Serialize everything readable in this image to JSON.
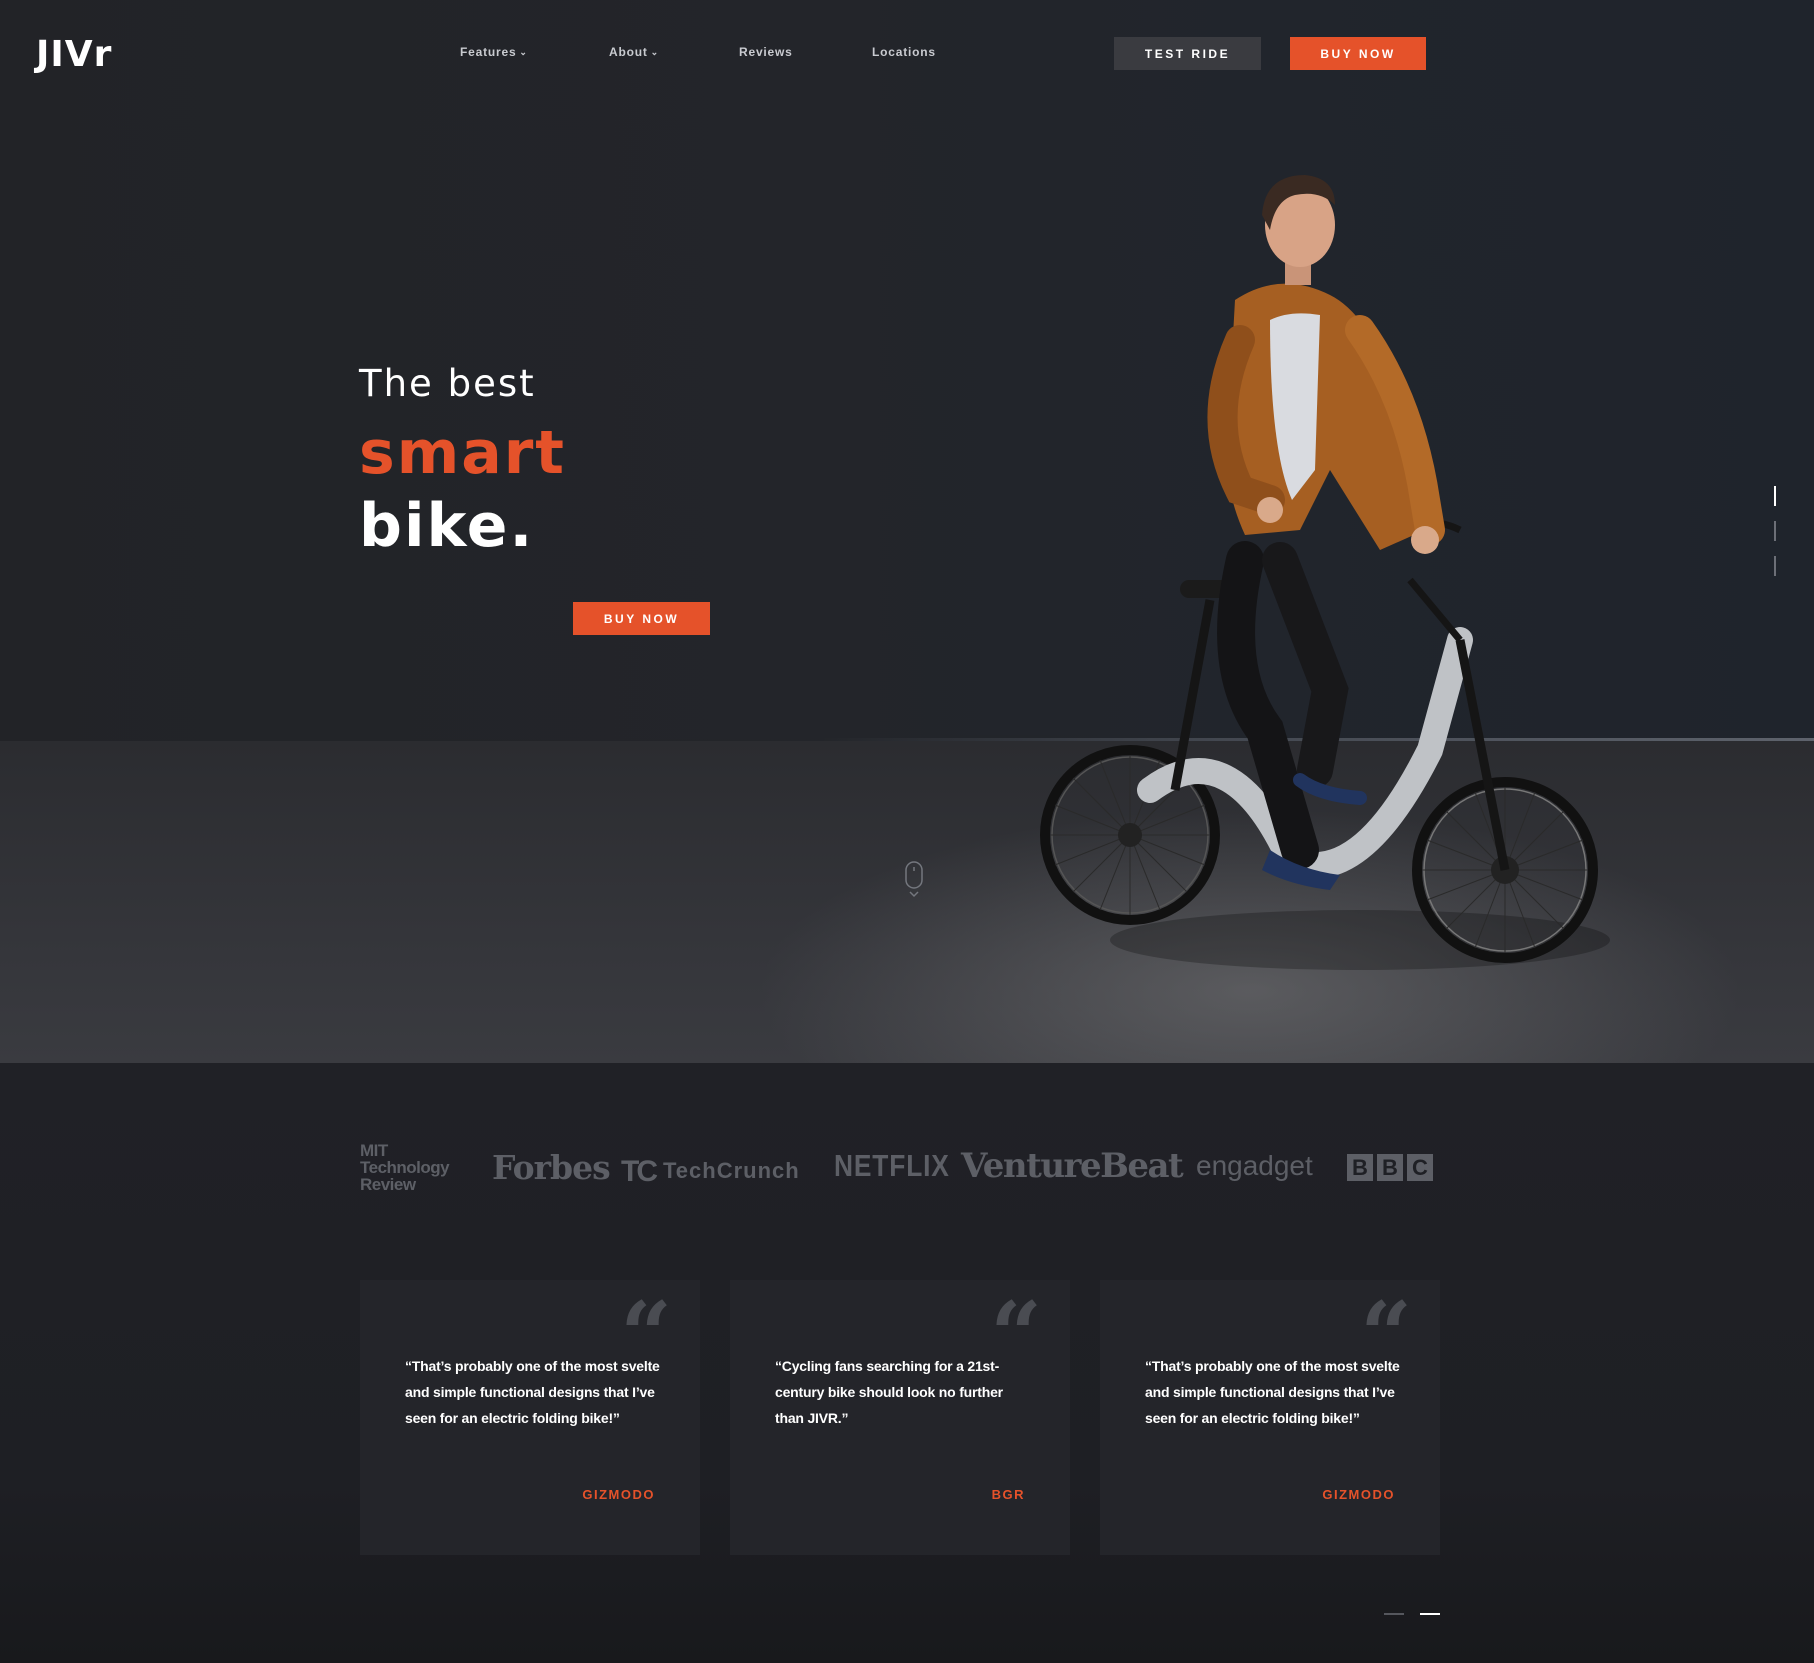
{
  "brand": {
    "logo_text": "JIVr",
    "accent": "#e5522a",
    "background": "#1d1e22"
  },
  "nav": {
    "items": [
      {
        "label": "Features",
        "has_dropdown": true
      },
      {
        "label": "About",
        "has_dropdown": true
      },
      {
        "label": "Reviews",
        "has_dropdown": false
      },
      {
        "label": "Locations",
        "has_dropdown": false
      }
    ],
    "dropdown_icon": "chevron-down-icon",
    "test_ride_label": "TEST RIDE",
    "buy_now_label": "BUY NOW"
  },
  "hero": {
    "line1": "The best",
    "line2": "smart",
    "line3": "bike.",
    "cta_label": "BUY NOW",
    "scroll_icon": "mouse-scroll-icon",
    "image": "man-riding-electric-folding-bike",
    "slide_count": 3,
    "active_slide": 1
  },
  "press": {
    "logos": [
      {
        "name": "mit-technology-review",
        "text": "MIT Technology Review"
      },
      {
        "name": "forbes",
        "text": "Forbes"
      },
      {
        "name": "techcrunch",
        "text": "TechCrunch"
      },
      {
        "name": "netflix",
        "text": "NETFLIX"
      },
      {
        "name": "venturebeat",
        "text": "VentureBeat"
      },
      {
        "name": "engadget",
        "text": "engadget"
      },
      {
        "name": "bbc",
        "text": "BBC"
      }
    ]
  },
  "testimonials": {
    "quote_icon": "quote-mark-icon",
    "cards": [
      {
        "quote": "“That’s probably one of the most svelte and simple functional designs that I’ve seen for an electric folding bike!”",
        "source": "GIZMODO"
      },
      {
        "quote": "“Cycling fans searching for a 21st-century bike should look no further than JIVR.”",
        "source": "BGR"
      },
      {
        "quote": "“That’s probably one of the most svelte and simple functional designs that I’ve seen for an electric folding bike!”",
        "source": "GIZMODO"
      }
    ],
    "page_count": 2,
    "active_page": 2
  }
}
